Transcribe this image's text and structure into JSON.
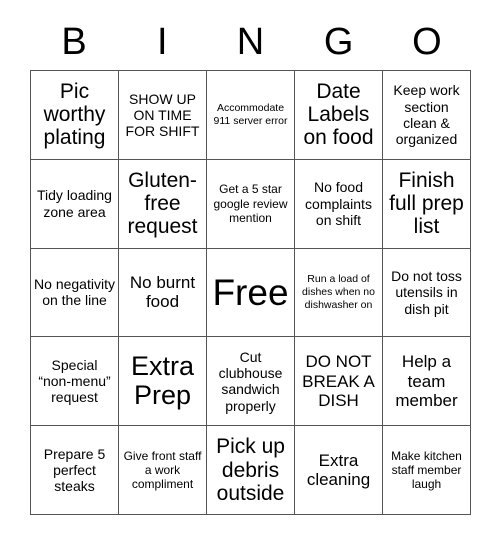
{
  "header": {
    "letters": [
      "B",
      "I",
      "N",
      "G",
      "O"
    ]
  },
  "grid": {
    "rows": [
      [
        {
          "text": "Pic worthy plating",
          "size": "xl"
        },
        {
          "text": "SHOW UP ON TIME FOR SHIFT",
          "size": "md"
        },
        {
          "text": "Accommodate 911 server error",
          "size": "xs"
        },
        {
          "text": "Date Labels on food",
          "size": "xl"
        },
        {
          "text": "Keep work section clean & organized",
          "size": "md"
        }
      ],
      [
        {
          "text": "Tidy loading zone area",
          "size": "md"
        },
        {
          "text": "Gluten-free request",
          "size": "xl"
        },
        {
          "text": "Get a 5 star google review mention",
          "size": "sm"
        },
        {
          "text": "No food complaints on shift",
          "size": "md"
        },
        {
          "text": "Finish full prep list",
          "size": "xl"
        }
      ],
      [
        {
          "text": "No negativity on the line",
          "size": "md"
        },
        {
          "text": "No burnt food",
          "size": "lg"
        },
        {
          "text": "Free",
          "size": "free"
        },
        {
          "text": "Run a load of dishes when no dishwasher on",
          "size": "xs"
        },
        {
          "text": "Do not toss utensils in dish pit",
          "size": "md"
        }
      ],
      [
        {
          "text": "Special “non-menu” request",
          "size": "md"
        },
        {
          "text": "Extra Prep",
          "size": "xxl"
        },
        {
          "text": "Cut clubhouse sandwich properly",
          "size": "md"
        },
        {
          "text": "DO NOT BREAK A DISH",
          "size": "lg"
        },
        {
          "text": "Help a team member",
          "size": "lg"
        }
      ],
      [
        {
          "text": "Prepare 5 perfect steaks",
          "size": "md"
        },
        {
          "text": "Give front staff a work compliment",
          "size": "sm"
        },
        {
          "text": "Pick up debris outside",
          "size": "xl"
        },
        {
          "text": "Extra cleaning",
          "size": "lg"
        },
        {
          "text": "Make kitchen staff member laugh",
          "size": "sm"
        }
      ]
    ]
  },
  "colors": {
    "background": "#ffffff",
    "text": "#000000",
    "gridline": "#555555"
  }
}
